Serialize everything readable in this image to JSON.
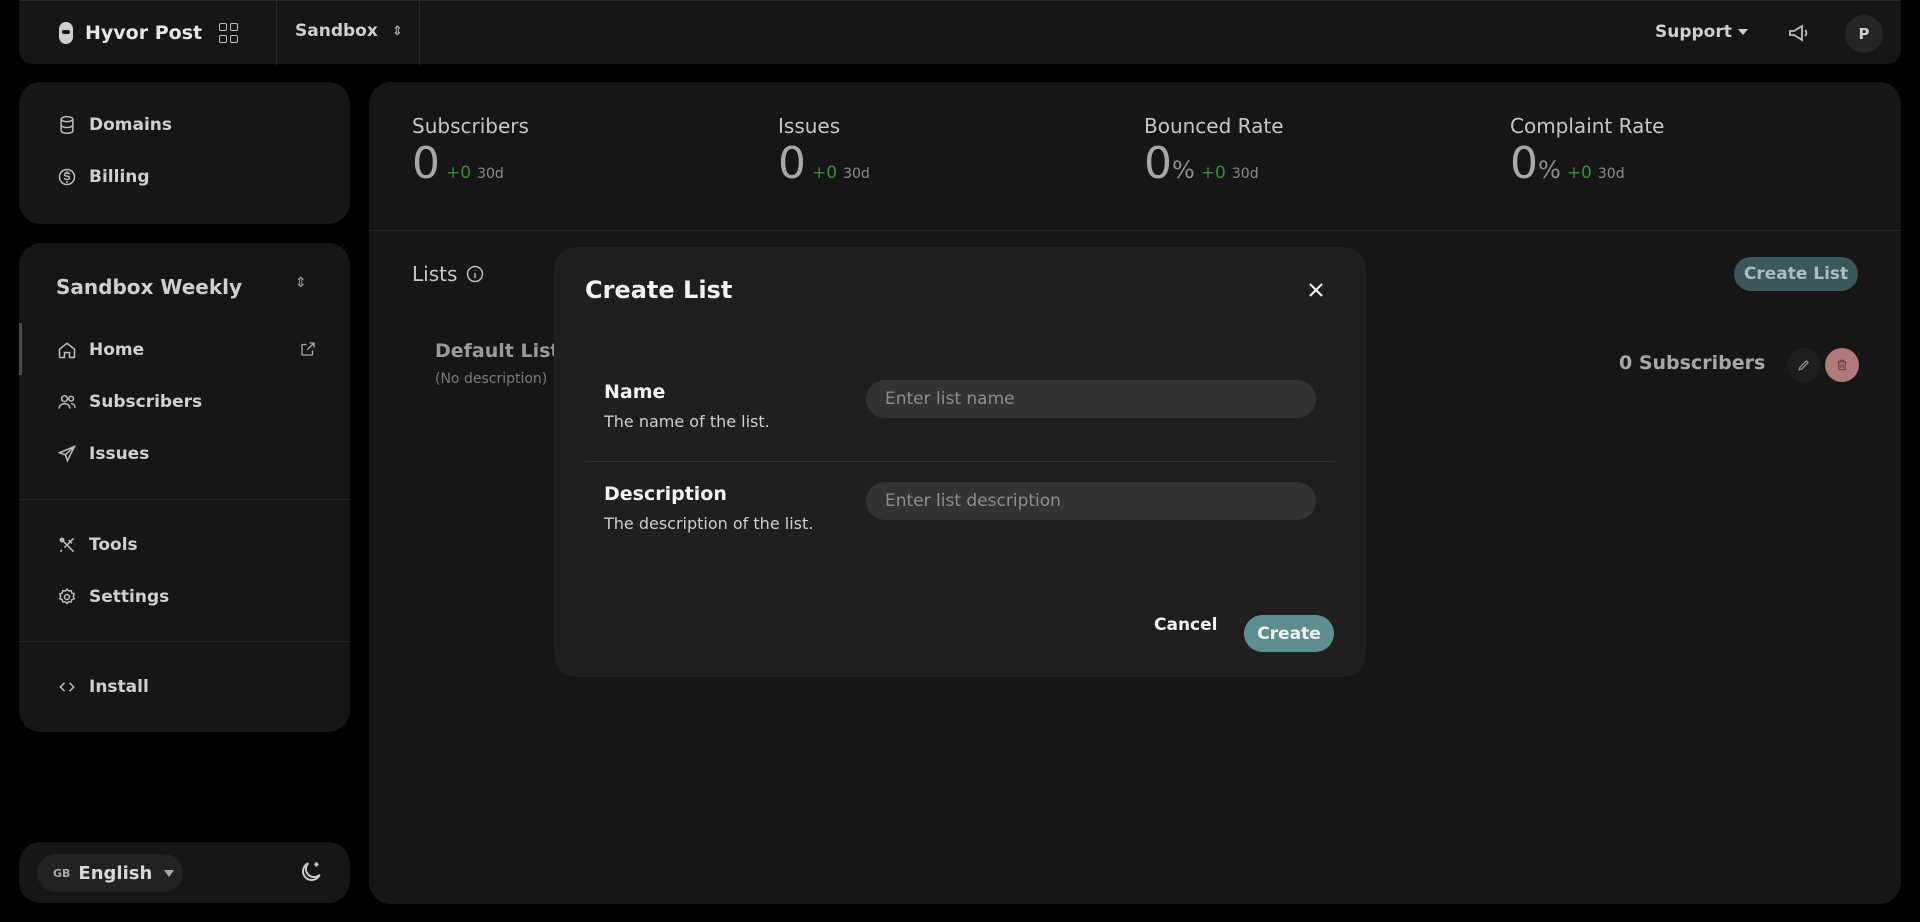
{
  "topbar": {
    "brand": "Hyvor Post",
    "project": "Sandbox",
    "support_label": "Support",
    "avatar_initial": "P"
  },
  "sidebar": {
    "top_items": [
      {
        "label": "Domains",
        "icon": "database-icon"
      },
      {
        "label": "Billing",
        "icon": "dollar-circle-icon"
      }
    ],
    "newsletter_name": "Sandbox Weekly",
    "items": [
      {
        "label": "Home",
        "icon": "home-icon"
      },
      {
        "label": "Subscribers",
        "icon": "users-icon"
      },
      {
        "label": "Issues",
        "icon": "send-icon"
      },
      {
        "label": "Tools",
        "icon": "tools-icon"
      },
      {
        "label": "Settings",
        "icon": "gear-icon"
      },
      {
        "label": "Install",
        "icon": "code-icon"
      }
    ],
    "language": {
      "flag": "GB",
      "label": "English"
    }
  },
  "stats": [
    {
      "label": "Subscribers",
      "value": "0",
      "pct": "",
      "delta": "+0",
      "period": "30d"
    },
    {
      "label": "Issues",
      "value": "0",
      "pct": "",
      "delta": "+0",
      "period": "30d"
    },
    {
      "label": "Bounced Rate",
      "value": "0",
      "pct": "%",
      "delta": "+0",
      "period": "30d"
    },
    {
      "label": "Complaint Rate",
      "value": "0",
      "pct": "%",
      "delta": "+0",
      "period": "30d"
    }
  ],
  "lists": {
    "title": "Lists",
    "create_label": "Create List",
    "items": [
      {
        "name": "Default List",
        "description": "(No description)",
        "subscribers": "0 Subscribers"
      }
    ]
  },
  "modal": {
    "title": "Create List",
    "name_label": "Name",
    "name_hint": "The name of the list.",
    "name_placeholder": "Enter list name",
    "description_label": "Description",
    "description_hint": "The description of the list.",
    "description_placeholder": "Enter list description",
    "cancel_label": "Cancel",
    "create_label": "Create"
  },
  "colors": {
    "background": "#000000",
    "panel": "#161616",
    "modal": "#1f1f1f",
    "accent": "#5f8e90",
    "delta_green": "#3b8a3b",
    "danger": "#b07a7a"
  }
}
